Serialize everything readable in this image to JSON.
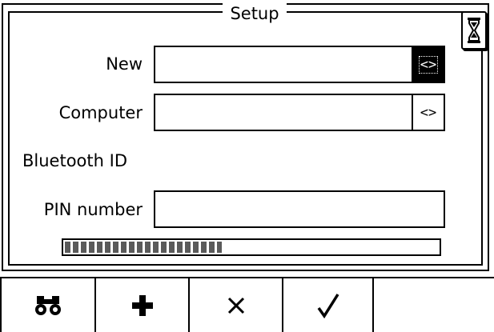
{
  "window": {
    "title": "Setup"
  },
  "status": {
    "icon": "hourglass-icon"
  },
  "form": {
    "new_label": "New",
    "new_value": "",
    "new_picker": "<>",
    "computer_label": "Computer",
    "computer_value": "",
    "computer_picker": "<>",
    "bluetooth_label": "Bluetooth ID",
    "pin_label": "PIN number",
    "pin_value": ""
  },
  "progress": {
    "fraction": 0.42
  },
  "toolbar": {
    "keys": [
      {
        "icon": "binoculars-icon"
      },
      {
        "icon": "plus-icon"
      },
      {
        "icon": "cross-icon"
      },
      {
        "icon": "checkmark-icon"
      },
      {
        "icon": ""
      }
    ]
  },
  "colors": {
    "foreground": "#000000",
    "background": "#ffffff",
    "progress_fill": "#5a5a5a"
  }
}
